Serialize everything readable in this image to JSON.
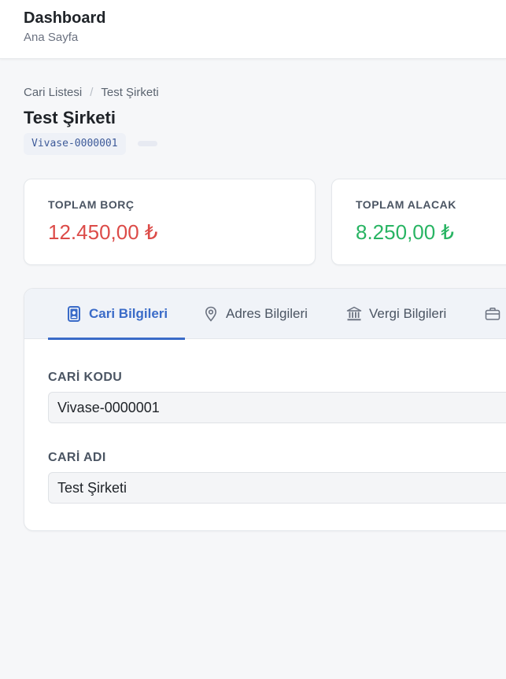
{
  "header": {
    "title": "Dashboard",
    "subtitle": "Ana Sayfa"
  },
  "breadcrumb": {
    "items": [
      "Cari Listesi",
      "Test Şirketi"
    ],
    "separator": "/"
  },
  "page": {
    "title": "Test Şirketi",
    "code_badge": "Vivase-0000001",
    "extra_badge": ""
  },
  "stats": {
    "debt": {
      "label": "TOPLAM BORÇ",
      "value": "12.450,00 ₺",
      "color": "#dc4b48"
    },
    "credit": {
      "label": "TOPLAM ALACAK",
      "value": "8.250,00 ₺",
      "color": "#28b463"
    }
  },
  "tabs": [
    {
      "label": "Cari Bilgileri",
      "icon": "id-badge-icon",
      "active": true
    },
    {
      "label": "Adres Bilgileri",
      "icon": "map-pin-icon",
      "active": false
    },
    {
      "label": "Vergi Bilgileri",
      "icon": "bank-icon",
      "active": false
    },
    {
      "label": "",
      "icon": "briefcase-icon",
      "active": false
    }
  ],
  "form": {
    "cari_kodu": {
      "label": "CARİ KODU",
      "value": "Vivase-0000001"
    },
    "cari_adi": {
      "label": "CARİ ADI",
      "value": "Test Şirketi"
    }
  },
  "colors": {
    "accent": "#3a6bc8",
    "background": "#f6f7f9"
  }
}
